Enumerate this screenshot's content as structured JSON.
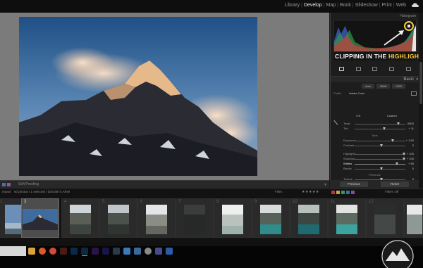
{
  "nav": {
    "modules": [
      "Library",
      "Develop",
      "Map",
      "Book",
      "Slideshow",
      "Print",
      "Web"
    ],
    "active": "Develop",
    "cloud_icon": "cloud-icon"
  },
  "canvas": {
    "background": "#7b7b7b",
    "photo_desc_icon": "mountain-photo"
  },
  "toolbar": {
    "softproof": "Soft Proofing"
  },
  "panel": {
    "histogram_label": "Histogram",
    "caption_main": "CLIPPING IN THE ",
    "caption_highlight": "HIGHLIGHTS",
    "basic_label": "Basic",
    "modes": [
      "Auto",
      "B&W",
      "HDR"
    ],
    "profile_label": "Profile",
    "profile_value": "Adobe Color",
    "wb_label": "WB",
    "wb_value": "Custom",
    "section_tone": "Tone",
    "section_presence": "Presence",
    "sliders_wb": [
      {
        "name": "Temp",
        "value": "6500"
      },
      {
        "name": "Tint",
        "value": "+ 11"
      }
    ],
    "sliders_tone1": [
      {
        "name": "Exposure",
        "value": "+ 1.50"
      },
      {
        "name": "Contrast",
        "value": "0"
      }
    ],
    "sliders_tone2": [
      {
        "name": "Highlights",
        "value": "+ 100"
      },
      {
        "name": "Shadows",
        "value": "+ 100"
      },
      {
        "name": "Whites",
        "value": "+ 80"
      },
      {
        "name": "Blacks",
        "value": "0"
      }
    ],
    "sliders_presence": [
      {
        "name": "Texture",
        "value": "0"
      },
      {
        "name": "Clarity",
        "value": "0"
      }
    ],
    "previous_label": "Previous",
    "reset_label": "Reset"
  },
  "filmstrip": {
    "import_label": "Import",
    "info": "60 photos / 1 selected / DSC6674.ARW",
    "filter_label": "Filter :",
    "filters_off": "Filters Off",
    "stars": "★★★★★",
    "cells": [
      "1",
      "3",
      "4",
      "5",
      "6",
      "7",
      "8",
      "9",
      "10",
      "11",
      "12"
    ]
  },
  "colors": {
    "highlight_yellow": "#f7c83a",
    "accent_blue": "#6aa0e0"
  }
}
